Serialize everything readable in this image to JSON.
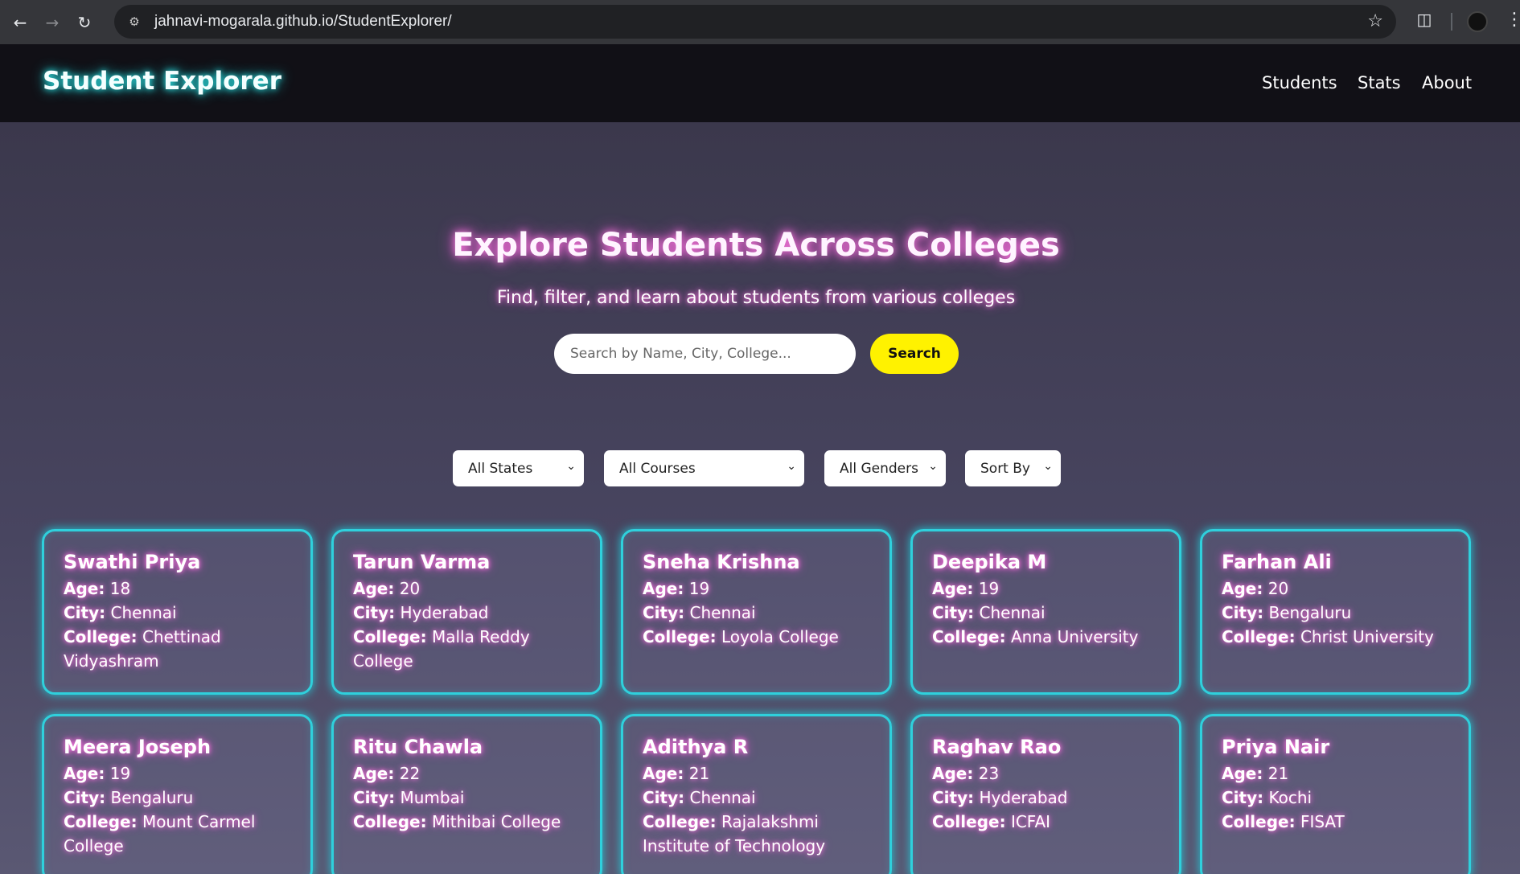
{
  "browser": {
    "url": "jahnavi-mogarala.github.io/StudentExplorer/"
  },
  "header": {
    "brand": "Student Explorer",
    "nav": [
      "Students",
      "Stats",
      "About"
    ]
  },
  "hero": {
    "title": "Explore Students Across Colleges",
    "subtitle": "Find, filter, and learn about students from various colleges",
    "search_placeholder": "Search by Name, City, College...",
    "search_button": "Search"
  },
  "filters": {
    "state": "All States",
    "course": "All Courses",
    "gender": "All Genders",
    "sort": "Sort By"
  },
  "labels": {
    "age": "Age:",
    "city": "City:",
    "college": "College:"
  },
  "students": [
    {
      "name": "Swathi Priya",
      "age": "18",
      "city": "Chennai",
      "college": "Chettinad Vidyashram"
    },
    {
      "name": "Tarun Varma",
      "age": "20",
      "city": "Hyderabad",
      "college": "Malla Reddy College"
    },
    {
      "name": "Sneha Krishna",
      "age": "19",
      "city": "Chennai",
      "college": "Loyola College"
    },
    {
      "name": "Deepika M",
      "age": "19",
      "city": "Chennai",
      "college": "Anna University"
    },
    {
      "name": "Farhan Ali",
      "age": "20",
      "city": "Bengaluru",
      "college": "Christ University"
    },
    {
      "name": "Meera Joseph",
      "age": "19",
      "city": "Bengaluru",
      "college": "Mount Carmel College"
    },
    {
      "name": "Ritu Chawla",
      "age": "22",
      "city": "Mumbai",
      "college": "Mithibai College"
    },
    {
      "name": "Adithya R",
      "age": "21",
      "city": "Chennai",
      "college": "Rajalakshmi Institute of Technology"
    },
    {
      "name": "Raghav Rao",
      "age": "23",
      "city": "Hyderabad",
      "college": "ICFAI"
    },
    {
      "name": "Priya Nair",
      "age": "21",
      "city": "Kochi",
      "college": "FISAT"
    }
  ]
}
